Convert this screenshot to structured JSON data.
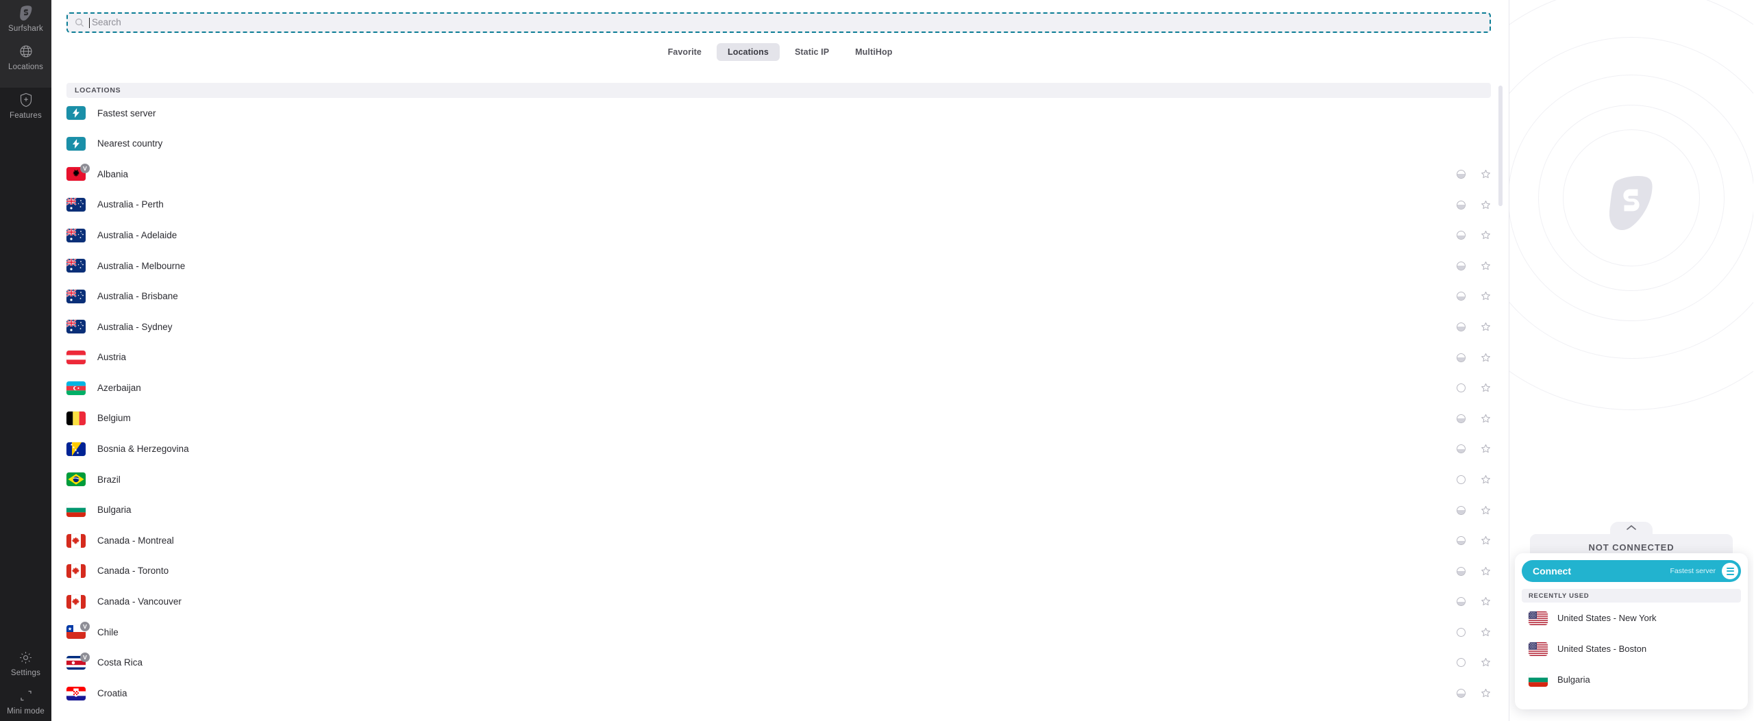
{
  "sidebar": {
    "items": [
      {
        "label": "Surfshark",
        "icon": "surfshark-logo-icon"
      },
      {
        "label": "Locations",
        "icon": "globe-icon"
      },
      {
        "label": "Features",
        "icon": "shield-plus-icon"
      },
      {
        "label": "Settings",
        "icon": "gear-icon"
      },
      {
        "label": "Mini mode",
        "icon": "mini-mode-icon"
      }
    ]
  },
  "search": {
    "placeholder": "Search",
    "value": "",
    "icon": "search-icon"
  },
  "tabs": [
    {
      "label": "Favorite",
      "active": false
    },
    {
      "label": "Locations",
      "active": true
    },
    {
      "label": "Static IP",
      "active": false
    },
    {
      "label": "MultiHop",
      "active": false
    }
  ],
  "list": {
    "section_header": "LOCATIONS",
    "rows": [
      {
        "label": "Fastest server",
        "flag": "bolt",
        "virtual": false,
        "actions": false
      },
      {
        "label": "Nearest country",
        "flag": "bolt",
        "virtual": false,
        "actions": false
      },
      {
        "label": "Albania",
        "flag": "al",
        "virtual": true,
        "actions": true,
        "load": "half"
      },
      {
        "label": "Australia - Perth",
        "flag": "au",
        "virtual": false,
        "actions": true,
        "load": "half"
      },
      {
        "label": "Australia - Adelaide",
        "flag": "au",
        "virtual": false,
        "actions": true,
        "load": "half"
      },
      {
        "label": "Australia - Melbourne",
        "flag": "au",
        "virtual": false,
        "actions": true,
        "load": "half"
      },
      {
        "label": "Australia - Brisbane",
        "flag": "au",
        "virtual": false,
        "actions": true,
        "load": "half"
      },
      {
        "label": "Australia - Sydney",
        "flag": "au",
        "virtual": false,
        "actions": true,
        "load": "half"
      },
      {
        "label": "Austria",
        "flag": "at",
        "virtual": false,
        "actions": true,
        "load": "half"
      },
      {
        "label": "Azerbaijan",
        "flag": "az",
        "virtual": false,
        "actions": true,
        "load": "empty"
      },
      {
        "label": "Belgium",
        "flag": "be",
        "virtual": false,
        "actions": true,
        "load": "half"
      },
      {
        "label": "Bosnia & Herzegovina",
        "flag": "ba",
        "virtual": false,
        "actions": true,
        "load": "half"
      },
      {
        "label": "Brazil",
        "flag": "br",
        "virtual": false,
        "actions": true,
        "load": "empty"
      },
      {
        "label": "Bulgaria",
        "flag": "bg",
        "virtual": false,
        "actions": true,
        "load": "half"
      },
      {
        "label": "Canada - Montreal",
        "flag": "ca",
        "virtual": false,
        "actions": true,
        "load": "half"
      },
      {
        "label": "Canada - Toronto",
        "flag": "ca",
        "virtual": false,
        "actions": true,
        "load": "half"
      },
      {
        "label": "Canada - Vancouver",
        "flag": "ca",
        "virtual": false,
        "actions": true,
        "load": "half"
      },
      {
        "label": "Chile",
        "flag": "cl",
        "virtual": true,
        "actions": true,
        "load": "empty"
      },
      {
        "label": "Costa Rica",
        "flag": "cr",
        "virtual": true,
        "actions": true,
        "load": "empty"
      },
      {
        "label": "Croatia",
        "flag": "hr",
        "virtual": false,
        "actions": true,
        "load": "half"
      }
    ]
  },
  "connection": {
    "status": "NOT CONNECTED",
    "collapse_icon": "chevron-up-icon",
    "connect_label": "Connect",
    "connect_server": "Fastest server",
    "menu_icon": "hamburger-icon",
    "recent_header": "RECENTLY USED",
    "recent": [
      {
        "label": "United States - New York",
        "flag": "us"
      },
      {
        "label": "United States - Boston",
        "flag": "us"
      },
      {
        "label": "Bulgaria",
        "flag": "bg"
      }
    ]
  },
  "colors": {
    "accent": "#22b3cf",
    "sidebar_bg": "#1e1e20",
    "focus_outline": "#0b7d95",
    "panel_gray": "#f1f1f5"
  }
}
